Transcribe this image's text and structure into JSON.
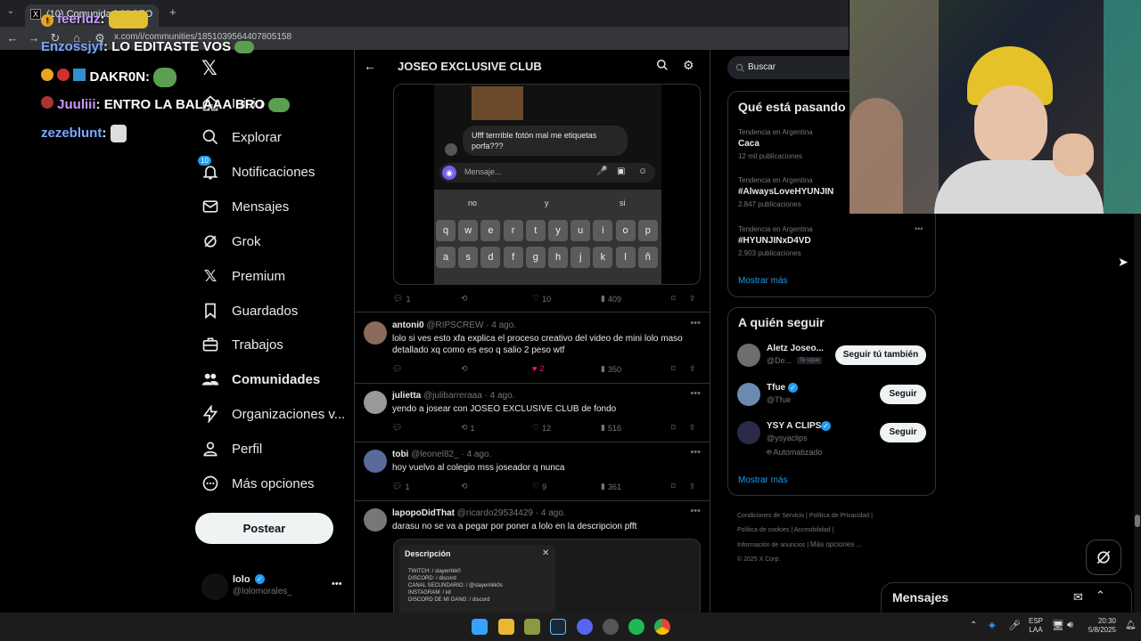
{
  "browser": {
    "tab_title": "(10) Comunidad JOSEO",
    "url": "x.com/i/communities/1851039564407805158"
  },
  "chat": [
    {
      "user": "feerldz",
      "message": ""
    },
    {
      "user": "Enzossjyf",
      "message": "LO EDITASTE VOS"
    },
    {
      "user": "DAKR0N",
      "message": ""
    },
    {
      "user": "Juuliii",
      "message": "ENTRO LA BALAAA BRO"
    },
    {
      "user": "zezeblunt",
      "message": ""
    }
  ],
  "nav": {
    "items": [
      {
        "label": "Inicio"
      },
      {
        "label": "Explorar"
      },
      {
        "label": "Notificaciones",
        "badge": "10"
      },
      {
        "label": "Mensajes"
      },
      {
        "label": "Grok"
      },
      {
        "label": "Premium"
      },
      {
        "label": "Guardados"
      },
      {
        "label": "Trabajos"
      },
      {
        "label": "Comunidades"
      },
      {
        "label": "Organizaciones v..."
      },
      {
        "label": "Perfil"
      },
      {
        "label": "Más opciones"
      }
    ],
    "post_button": "Postear",
    "account": {
      "name": "lolo",
      "handle": "@lolomorales_"
    }
  },
  "feed": {
    "title": "JOSEO EXCLUSIVE CLUB",
    "phone": {
      "message": "Ufff terrrible fotón mal me etiquetas porfa???",
      "input_placeholder": "Mensaje...",
      "suggestions": [
        "no",
        "y",
        "si"
      ],
      "row1": [
        "q",
        "w",
        "e",
        "r",
        "t",
        "y",
        "u",
        "i",
        "o",
        "p"
      ],
      "row2": [
        "a",
        "s",
        "d",
        "f",
        "g",
        "h",
        "j",
        "k",
        "l",
        "ñ"
      ]
    },
    "first_actions": {
      "replies": "1",
      "likes": "10",
      "views": "409"
    },
    "tweets": [
      {
        "name": "antoni0",
        "handle": "@RIPSCREW",
        "time": "4 ago.",
        "text": "lolo si ves esto xfa explica el proceso creativo del video de mini lolo maso detallado xq como es eso q salio 2 peso wtf",
        "replies": "",
        "retweets": "",
        "likes": "2",
        "views": "350"
      },
      {
        "name": "julietta",
        "handle": "@julibarreraaa",
        "time": "4 ago.",
        "text": "yendo a josear con JOSEO EXCLUSIVE CLUB de fondo",
        "replies": "",
        "retweets": "1",
        "likes": "12",
        "views": "516"
      },
      {
        "name": "tobi",
        "handle": "@leonel82_",
        "time": "4 ago.",
        "text": "hoy vuelvo al colegio mss joseador q nunca",
        "replies": "1",
        "retweets": "",
        "likes": "9",
        "views": "361"
      },
      {
        "name": "lapopoDidThat",
        "handle": "@ricardo29534429",
        "time": "4 ago.",
        "text": "darasu no se va a pegar por poner a lolo en la descripcion pfft",
        "replies": "",
        "retweets": "",
        "likes": "",
        "views": ""
      }
    ],
    "desc_card": {
      "title": "Descripción",
      "lines": [
        "TWITCH: / slayerrikk0",
        "DISCORD: / discord",
        "CANAL SECUNDARIO: / @slayerrikk0s",
        "INSTAGRAM: / kit",
        "DISCORD DE MI GANG: / discord"
      ]
    }
  },
  "sidebar": {
    "search_placeholder": "Buscar",
    "trends_title": "Qué está pasando",
    "trends": [
      {
        "context": "Tendencia en Argentina",
        "name": "Caca",
        "count": "12 mil publicaciones"
      },
      {
        "context": "Tendencia en Argentina",
        "name": "#AlwaysLoveHYUNJIN",
        "count": "2.847 publicaciones"
      },
      {
        "context": "Tendencia en Argentina",
        "name": "#HYUNJINxD4VD",
        "count": "2.903 publicaciones"
      }
    ],
    "show_more": "Mostrar más",
    "who_title": "A quién seguir",
    "who": [
      {
        "name": "Aletz Joseo...",
        "handle": "@De...",
        "badge": "Te sigue",
        "button": "Seguir tú también",
        "extra": ""
      },
      {
        "name": "Tfue",
        "handle": "@Tfue",
        "badge": "",
        "button": "Seguir",
        "extra": ""
      },
      {
        "name": "YSY A CLIPS",
        "handle": "@ysyaclips",
        "badge": "",
        "button": "Seguir",
        "extra": "Automatizado"
      }
    ],
    "footer": [
      "Condiciones de Servicio",
      "Política de Privacidad",
      "Política de cookies",
      "Accesibilidad",
      "Información de anuncios",
      "Más opciones ...",
      "© 2025 X Corp."
    ],
    "messages_label": "Mensajes"
  },
  "taskbar": {
    "lang": "ESP",
    "lang2": "LAA",
    "time": "20:30",
    "date": "5/8/2025"
  },
  "colors": {
    "accent": "#1d9bf0",
    "like": "#f91880",
    "bg": "#000000",
    "border": "#2f3336"
  }
}
